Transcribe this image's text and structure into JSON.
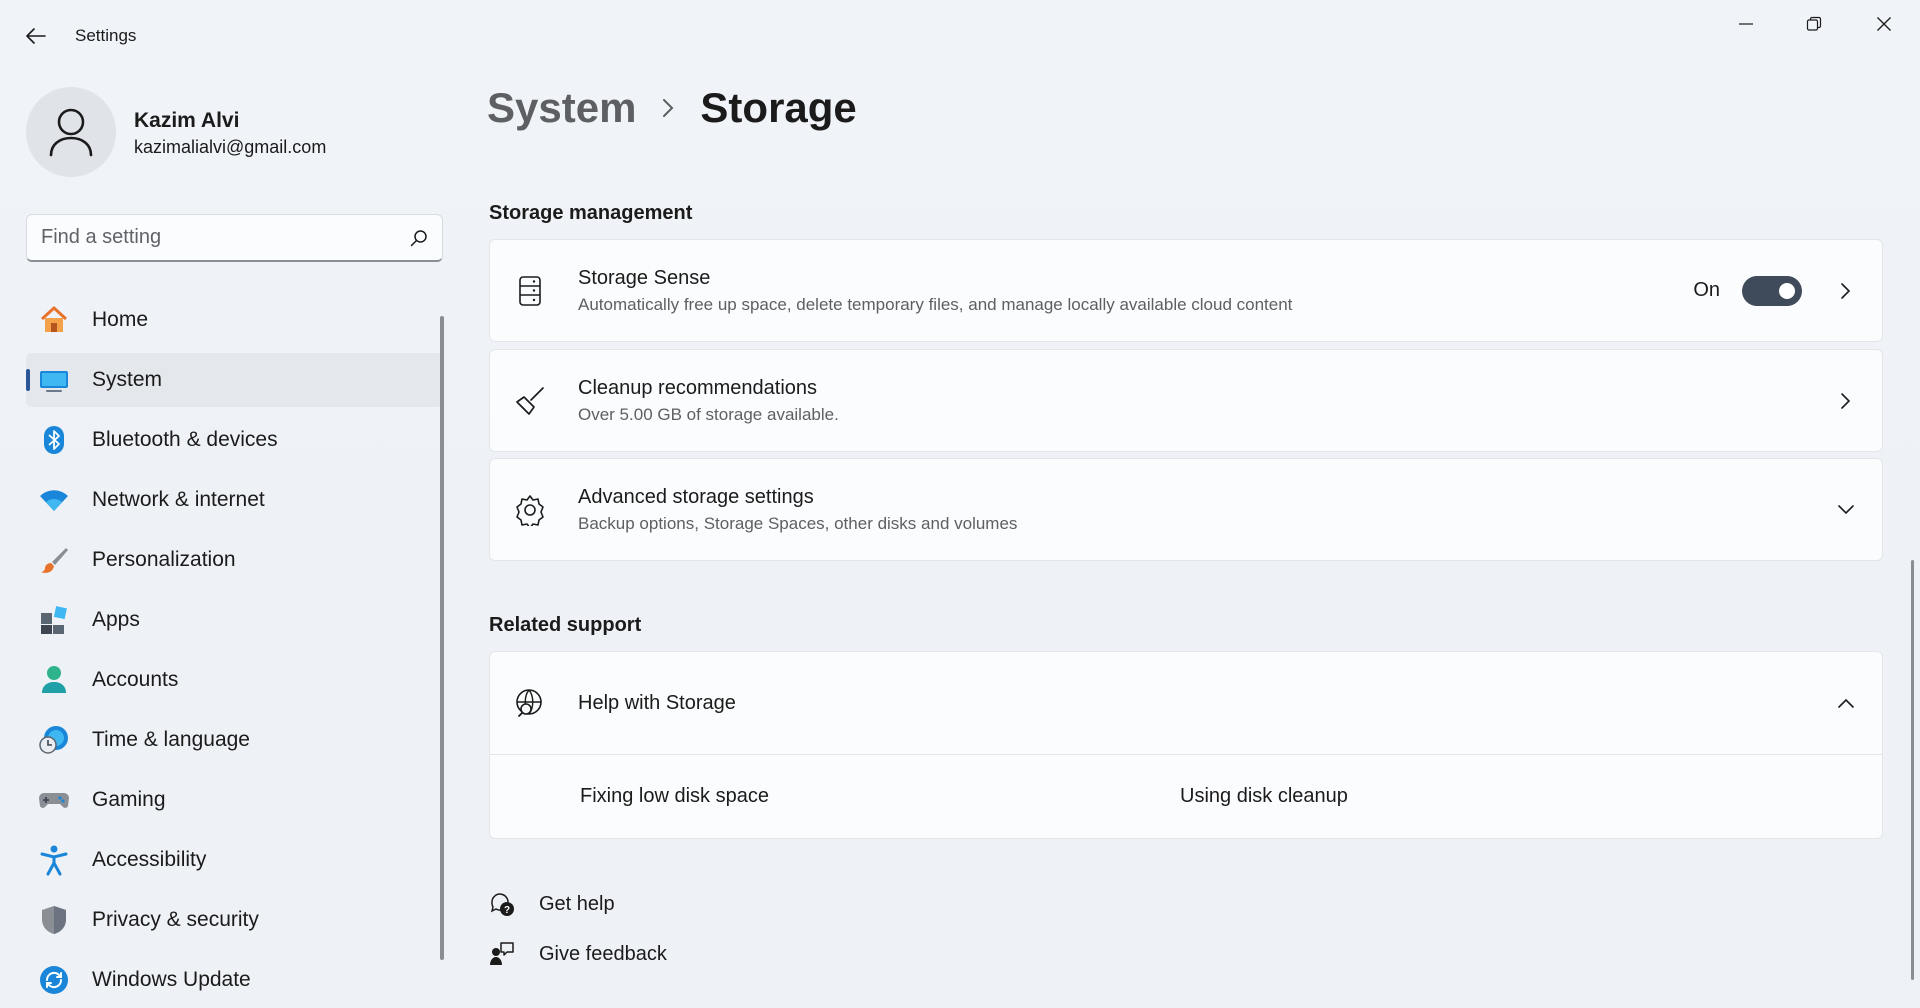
{
  "window": {
    "title": "Settings"
  },
  "profile": {
    "name": "Kazim Alvi",
    "email": "kazimalialvi@gmail.com"
  },
  "search": {
    "placeholder": "Find a setting"
  },
  "nav": {
    "items": [
      {
        "label": "Home",
        "icon": "home-icon"
      },
      {
        "label": "System",
        "icon": "system-icon",
        "active": true
      },
      {
        "label": "Bluetooth & devices",
        "icon": "bluetooth-icon"
      },
      {
        "label": "Network & internet",
        "icon": "wifi-icon"
      },
      {
        "label": "Personalization",
        "icon": "brush-icon"
      },
      {
        "label": "Apps",
        "icon": "apps-icon"
      },
      {
        "label": "Accounts",
        "icon": "accounts-icon"
      },
      {
        "label": "Time & language",
        "icon": "globe-clock-icon"
      },
      {
        "label": "Gaming",
        "icon": "gamepad-icon"
      },
      {
        "label": "Accessibility",
        "icon": "accessibility-icon"
      },
      {
        "label": "Privacy & security",
        "icon": "shield-icon"
      },
      {
        "label": "Windows Update",
        "icon": "update-icon"
      }
    ]
  },
  "breadcrumb": {
    "parent": "System",
    "current": "Storage"
  },
  "storage_management": {
    "heading": "Storage management",
    "storage_sense": {
      "title": "Storage Sense",
      "subtitle": "Automatically free up space, delete temporary files, and manage locally available cloud content",
      "toggle_label": "On",
      "toggle_on": true
    },
    "cleanup": {
      "title": "Cleanup recommendations",
      "subtitle": "Over 5.00 GB of storage available."
    },
    "advanced": {
      "title": "Advanced storage settings",
      "subtitle": "Backup options, Storage Spaces, other disks and volumes"
    }
  },
  "related_support": {
    "heading": "Related support",
    "help": {
      "title": "Help with Storage",
      "links": [
        "Fixing low disk space",
        "Using disk cleanup"
      ]
    }
  },
  "footer": {
    "get_help": "Get help",
    "give_feedback": "Give feedback"
  },
  "colors": {
    "accent": "#2b5797",
    "toggle_on": "#3f4b5a",
    "background": "#eef1f5"
  }
}
